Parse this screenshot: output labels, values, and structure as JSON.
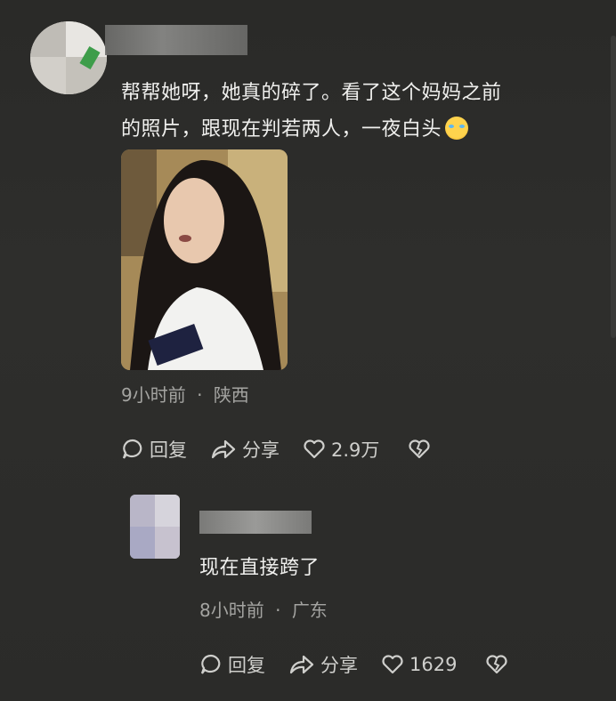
{
  "comment": {
    "text_line1": "帮帮她呀，她真的碎了。看了这个妈妈之前",
    "text_line2": "的照片，跟现在判若两人，一夜白头",
    "emoji": "loudly-crying-face",
    "time": "9小时前",
    "separator": "·",
    "location": "陕西",
    "reply_label": "回复",
    "share_label": "分享",
    "like_count": "2.9万"
  },
  "reply": {
    "text": "现在直接跨了",
    "time": "8小时前",
    "separator": "·",
    "location": "广东",
    "reply_label": "回复",
    "share_label": "分享",
    "like_count": "1629"
  },
  "colors": {
    "background": "#2c2c2a",
    "text": "#f0f0ee",
    "meta": "#a4a4a1"
  }
}
